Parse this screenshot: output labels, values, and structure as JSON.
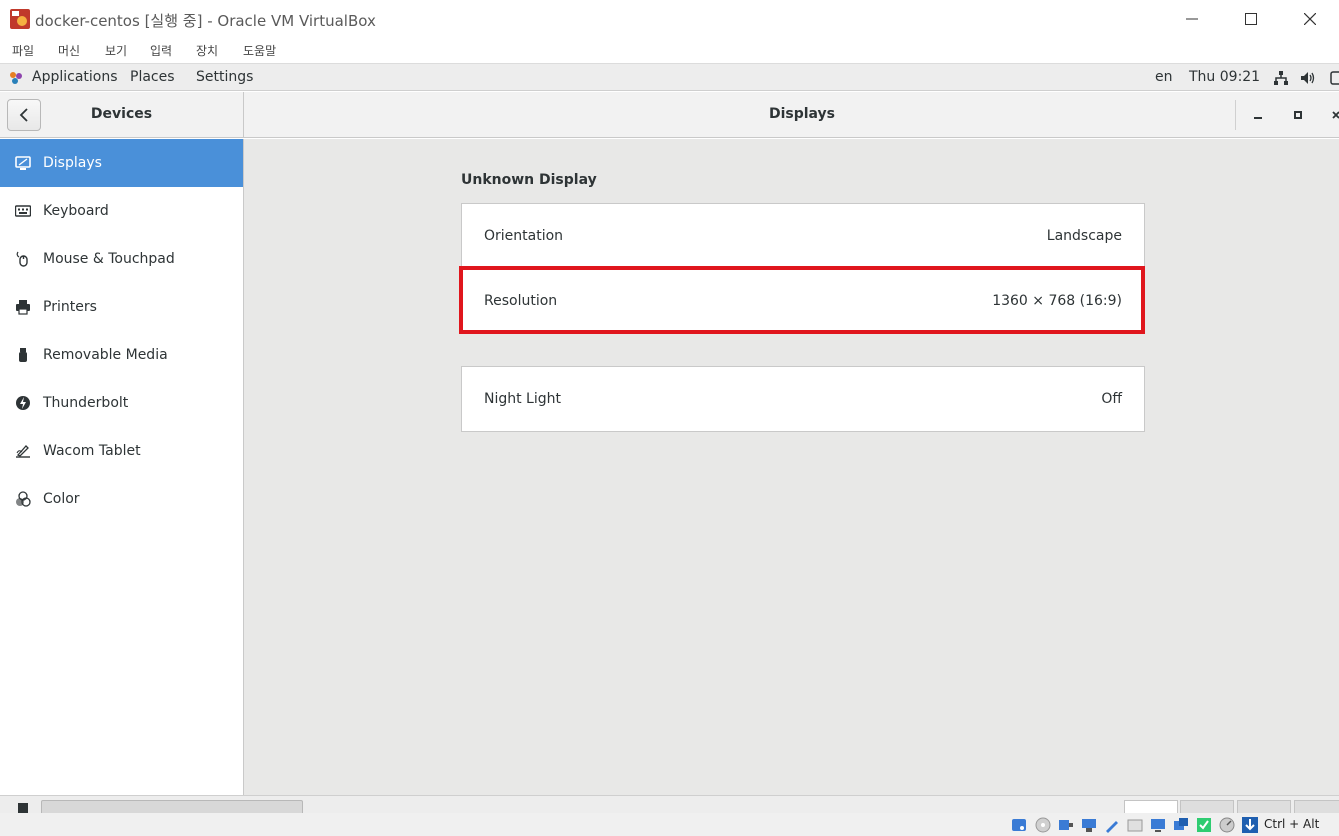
{
  "window": {
    "title": "docker-centos [실행 중] - Oracle VM VirtualBox"
  },
  "host_menu": [
    "파일",
    "머신",
    "보기",
    "입력",
    "장치",
    "도움말"
  ],
  "topbar": {
    "applications": "Applications",
    "places": "Places",
    "settings": "Settings",
    "lang": "en",
    "clock": "Thu 09:21"
  },
  "header": {
    "left_title": "Devices",
    "title": "Displays"
  },
  "sidebar": {
    "items": [
      {
        "label": "Displays",
        "icon": "display-icon",
        "active": true
      },
      {
        "label": "Keyboard",
        "icon": "keyboard-icon"
      },
      {
        "label": "Mouse & Touchpad",
        "icon": "mouse-icon"
      },
      {
        "label": "Printers",
        "icon": "printer-icon"
      },
      {
        "label": "Removable Media",
        "icon": "usb-icon"
      },
      {
        "label": "Thunderbolt",
        "icon": "thunderbolt-icon"
      },
      {
        "label": "Wacom Tablet",
        "icon": "tablet-icon"
      },
      {
        "label": "Color",
        "icon": "color-icon"
      }
    ]
  },
  "display": {
    "section_title": "Unknown Display",
    "orientation_label": "Orientation",
    "orientation_value": "Landscape",
    "resolution_label": "Resolution",
    "resolution_value": "1360 × 768 (16:9)",
    "night_light_label": "Night Light",
    "night_light_value": "Off"
  },
  "statusbar": {
    "host_key": "Ctrl + Alt"
  },
  "colors": {
    "accent": "#4a90d9",
    "highlight": "#e0161d"
  }
}
